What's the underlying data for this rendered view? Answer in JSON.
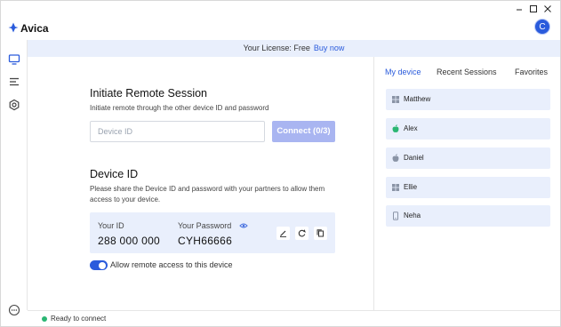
{
  "app": {
    "name": "Avica",
    "avatar_initial": "C"
  },
  "window_controls": [
    "minimize",
    "maximize",
    "close"
  ],
  "license": {
    "text": "Your License: Free",
    "link": "Buy now"
  },
  "nav": [
    {
      "icon": "monitor-icon"
    },
    {
      "icon": "list-icon"
    },
    {
      "icon": "gear-icon"
    },
    {
      "icon": "more-icon"
    }
  ],
  "session": {
    "title": "Initiate Remote Session",
    "subtitle": "Initiate remote through the other device ID and password",
    "placeholder": "Device ID",
    "connect_label": "Connect (0/3)"
  },
  "device": {
    "title": "Device ID",
    "subtitle_line1": "Please share the Device ID and password with your partners to allow them",
    "subtitle_line2": "access to your device.",
    "id_label": "Your ID",
    "id_value": "288 000 000",
    "password_label": "Your Password",
    "password_value": "CYH66666",
    "remote_access_label": "Allow remote access to this device",
    "remote_access_enabled": true
  },
  "right_tabs": [
    {
      "label": "My device",
      "active": true
    },
    {
      "label": "Recent Sessions",
      "active": false
    },
    {
      "label": "Favorites",
      "active": false
    }
  ],
  "devices": [
    {
      "name": "Matthew",
      "os": "windows-icon"
    },
    {
      "name": "Alex",
      "os": "apple-icon"
    },
    {
      "name": "Daniel",
      "os": "apple-icon"
    },
    {
      "name": "Ellie",
      "os": "windows-icon"
    },
    {
      "name": "Neha",
      "os": "phone-icon"
    }
  ],
  "status": {
    "text": "Ready to connect",
    "color": "#2bb673"
  },
  "colors": {
    "accent": "#2a5bdc",
    "panel": "#e9effc",
    "connect_disabled": "#a9b5f1"
  }
}
